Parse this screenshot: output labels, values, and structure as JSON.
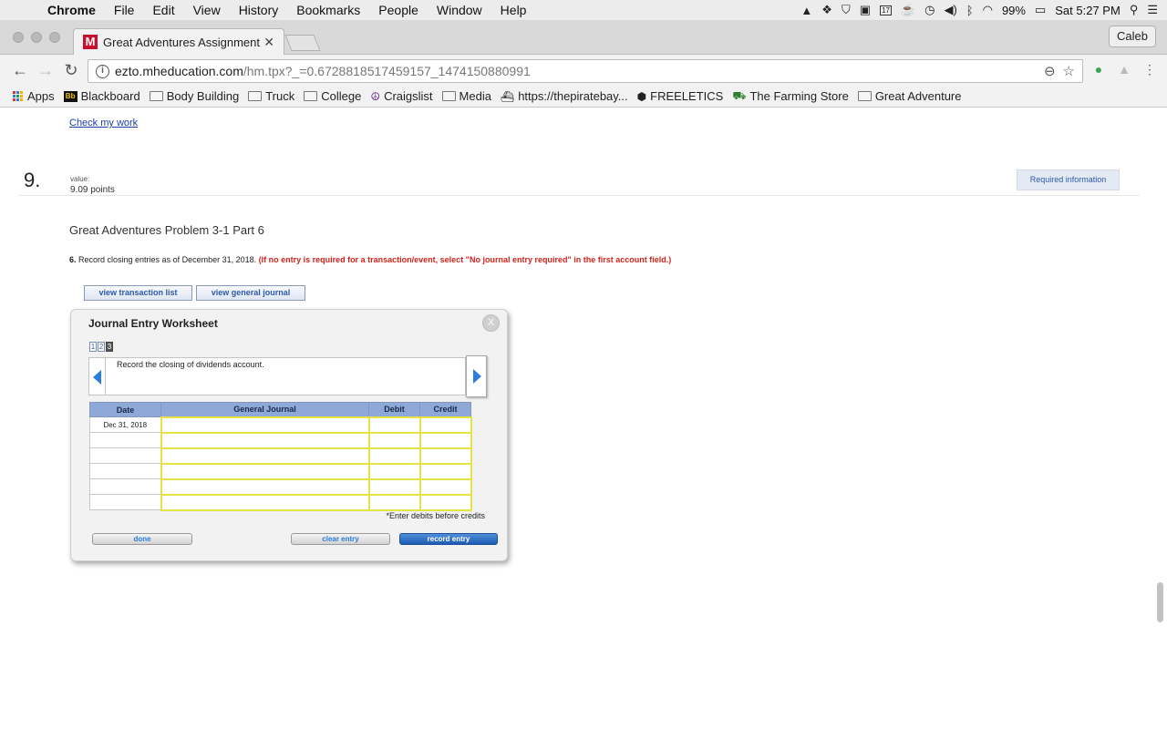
{
  "menubar": {
    "apple": "",
    "items": [
      "Chrome",
      "File",
      "Edit",
      "View",
      "History",
      "Bookmarks",
      "People",
      "Window",
      "Help"
    ],
    "battery": "99%",
    "clock": "Sat 5:27 PM",
    "calendar_day": "17"
  },
  "tabs": {
    "active_title": "Great Adventures Assignment",
    "favicon_letter": "M",
    "profile_name": "Caleb"
  },
  "omnibox": {
    "host": "ezto.mheducation.com",
    "path": "/hm.tpx?_=0.6728818517459157_1474150880991"
  },
  "bookmarks": [
    {
      "label": "Apps",
      "icon": "apps-grid-icon"
    },
    {
      "label": "Blackboard",
      "icon": "blackboard-icon"
    },
    {
      "label": "Body Building",
      "icon": "folder-icon"
    },
    {
      "label": "Truck",
      "icon": "folder-icon"
    },
    {
      "label": "College",
      "icon": "folder-icon"
    },
    {
      "label": "Craigslist",
      "icon": "peace-icon"
    },
    {
      "label": "Media",
      "icon": "folder-icon"
    },
    {
      "label": "https://thepiratebay...",
      "icon": "ship-icon"
    },
    {
      "label": "FREELETICS",
      "icon": "shield-icon"
    },
    {
      "label": "The Farming Store",
      "icon": "tractor-icon"
    },
    {
      "label": "Great Adventure",
      "icon": "folder-icon"
    }
  ],
  "page": {
    "check_my_work": "Check my work",
    "question_number": "9.",
    "value_label": "value:",
    "points": "9.09 points",
    "required_information": "Required information",
    "problem_title": "Great Adventures Problem 3-1 Part 6",
    "instruction_num": "6.",
    "instruction_text": " Record closing entries as of December 31, 2018. ",
    "instruction_red": "(If no entry is required for a transaction/event, select \"No journal entry required\" in the first account field.)",
    "view_transaction_list": "view transaction list",
    "view_general_journal": "view general journal"
  },
  "worksheet": {
    "title": "Journal Entry Worksheet",
    "close": "X",
    "pages": [
      "1",
      "2",
      "3"
    ],
    "description": "Record the closing of dividends account.",
    "columns": [
      "Date",
      "General Journal",
      "Debit",
      "Credit"
    ],
    "rows": [
      {
        "date": "Dec 31, 2018",
        "account": "",
        "debit": "",
        "credit": ""
      },
      {
        "date": "",
        "account": "",
        "debit": "",
        "credit": ""
      },
      {
        "date": "",
        "account": "",
        "debit": "",
        "credit": ""
      },
      {
        "date": "",
        "account": "",
        "debit": "",
        "credit": ""
      },
      {
        "date": "",
        "account": "",
        "debit": "",
        "credit": ""
      },
      {
        "date": "",
        "account": "",
        "debit": "",
        "credit": ""
      }
    ],
    "note": "*Enter debits before credits",
    "done": "done",
    "clear_entry": "clear entry",
    "record_entry": "record entry"
  },
  "colors": {
    "instruction_red": "#d3231b",
    "header_blue": "#8ea8d8",
    "input_border": "#e5e345",
    "primary_button": "#1d5bb3"
  }
}
